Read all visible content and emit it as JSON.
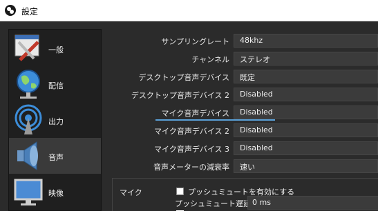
{
  "window": {
    "title": "設定"
  },
  "sidebar": {
    "items": [
      {
        "label": "一般",
        "icon": "tools-icon"
      },
      {
        "label": "配信",
        "icon": "globe-icon"
      },
      {
        "label": "出力",
        "icon": "antenna-icon"
      },
      {
        "label": "音声",
        "icon": "speaker-icon"
      },
      {
        "label": "映像",
        "icon": "monitor-icon"
      }
    ],
    "active_index": 3
  },
  "audio": {
    "rows": [
      {
        "label": "サンプリングレート",
        "value": "48khz"
      },
      {
        "label": "チャンネル",
        "value": "ステレオ"
      },
      {
        "label": "デスクトップ音声デバイス",
        "value": "既定"
      },
      {
        "label": "デスクトップ音声デバイス 2",
        "value": "Disabled"
      },
      {
        "label": "マイク音声デバイス",
        "value": "Disabled"
      },
      {
        "label": "マイク音声デバイス 2",
        "value": "Disabled"
      },
      {
        "label": "マイク音声デバイス 3",
        "value": "Disabled"
      },
      {
        "label": "音声メーターの減衰率",
        "value": "速い"
      }
    ]
  },
  "mic_group": {
    "title": "マイク",
    "push_to_mute_label": "プッシュミュートを有効にする",
    "push_to_mute_checked": false,
    "delay_label": "プッシュミュート遅延",
    "delay_value": "0 ms"
  },
  "colors": {
    "accent": "#5aa0d8",
    "background": "#2b2b2b",
    "active_item": "#3a3a3a"
  }
}
